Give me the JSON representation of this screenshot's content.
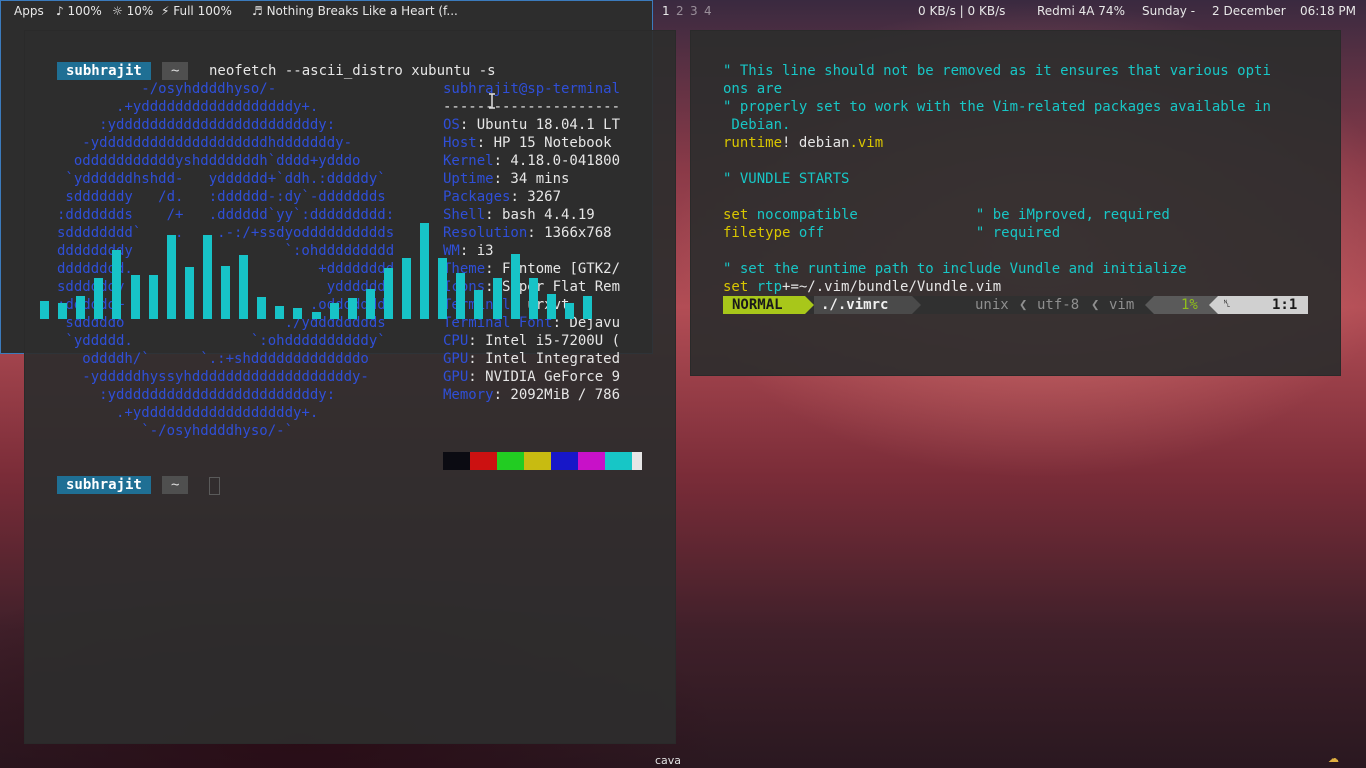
{
  "topbar": {
    "apps": "Apps",
    "volume": "♪ 100%",
    "brightness": "☼ 10%",
    "battery": "⚡ Full 100%",
    "music": "♬ Nothing Breaks Like a Heart (f...",
    "workspaces": [
      "1",
      "2",
      "3",
      "4"
    ],
    "net": "0 KB/s | 0 KB/s",
    "wifi": "Redmi 4A  74%",
    "day": "Sunday -",
    "date": "2 December",
    "time": "06:18 PM"
  },
  "terminal": {
    "user": "subhrajit",
    "dir": "~",
    "command": "neofetch --ascii_distro xubuntu -s",
    "ascii": [
      "          -/osyhddddhyso/-",
      "       .+yddddddddddddddddddy+.",
      "     :yddddddddddddddddddddddddy:",
      "   -yddddddddddddddddddddhdddddddy-",
      "  odddddddddddyshdddddddh`dddd+ydddo",
      " `yddddddhshdd-   ydddddd+`ddh.:dddddy`",
      " sddddddy   /d.   :dddddd-:dy`-ddddddds",
      ":ddddddds    /+   .dddddd`yy`:ddddddddd:",
      "sdddddddd`    .    .-:/+ssdyodddddddddds",
      "ddddddddy                  `:ohddddddddd",
      "dddddddd.                      +dddddddd",
      "sddddddy                        ydddddds",
      ":dddddd+                      .oddddddd:",
      " sdddddo                   ./ydddddddds",
      " `yddddd.              `:ohddddddddddy`",
      "   oddddh/`      `.:+shdddddddddddddo",
      "   -ydddddhyssyhdddddddddddddddddddy-",
      "     :yddddddddddddddddddddddddy:",
      "       .+yddddddddddddddddddy+.",
      "          `-/osyhddddhyso/-`"
    ],
    "info_header": "subhrajit@sp-terminal",
    "info_sep": "---------------------",
    "info": [
      {
        "key": "OS",
        "value": "Ubuntu 18.04.1 LT"
      },
      {
        "key": "Host",
        "value": "HP 15 Notebook"
      },
      {
        "key": "Kernel",
        "value": "4.18.0-041800"
      },
      {
        "key": "Uptime",
        "value": "34 mins"
      },
      {
        "key": "Packages",
        "value": "3267"
      },
      {
        "key": "Shell",
        "value": "bash 4.4.19"
      },
      {
        "key": "Resolution",
        "value": "1366x768"
      },
      {
        "key": "WM",
        "value": "i3"
      },
      {
        "key": "Theme",
        "value": "Fantome [GTK2/"
      },
      {
        "key": "Icons",
        "value": "Super Flat Rem"
      },
      {
        "key": "Terminal",
        "value": "urxvt"
      },
      {
        "key": "Terminal Font",
        "value": "Dejavu"
      },
      {
        "key": "CPU",
        "value": "Intel i5-7200U ("
      },
      {
        "key": "GPU",
        "value": "Intel Integrated"
      },
      {
        "key": "GPU",
        "value": "NVIDIA GeForce 9"
      },
      {
        "key": "Memory",
        "value": "2092MiB / 786"
      }
    ],
    "palette": [
      "#0b0b12",
      "#cc1111",
      "#22cc22",
      "#c8bb11",
      "#1717c8",
      "#c811c8",
      "#17c6c6",
      "#e6e6e6"
    ]
  },
  "vim": {
    "lines": [
      [
        {
          "t": "\" This line should not be removed as it ensures that various opti",
          "c": "cm"
        }
      ],
      [
        {
          "t": "ons are",
          "c": "cm"
        }
      ],
      [
        {
          "t": "\" properly set to work with the Vim-related packages available in",
          "c": "cm"
        }
      ],
      [
        {
          "t": " Debian.",
          "c": "cm"
        }
      ],
      [
        {
          "t": "runtime",
          "c": "kw"
        },
        {
          "t": "! debian",
          "c": "st"
        },
        {
          "t": ".vim",
          "c": "kw"
        }
      ],
      [
        {
          "t": "",
          "c": "st"
        }
      ],
      [
        {
          "t": "\" VUNDLE STARTS",
          "c": "cm"
        }
      ],
      [
        {
          "t": "",
          "c": "st"
        }
      ],
      [
        {
          "t": "set ",
          "c": "kw"
        },
        {
          "t": "nocompatible",
          "c": "id"
        },
        {
          "t": "              ",
          "c": "st"
        },
        {
          "t": "\" be iMproved, required",
          "c": "cm"
        }
      ],
      [
        {
          "t": "filetype ",
          "c": "kw"
        },
        {
          "t": "off",
          "c": "id"
        },
        {
          "t": "                  ",
          "c": "st"
        },
        {
          "t": "\" required",
          "c": "cm"
        }
      ],
      [
        {
          "t": "",
          "c": "st"
        }
      ],
      [
        {
          "t": "\" set the runtime path to include Vundle and initialize",
          "c": "cm"
        }
      ],
      [
        {
          "t": "set ",
          "c": "kw"
        },
        {
          "t": "rtp",
          "c": "id"
        },
        {
          "t": "+=~/.vim/bundle/Vundle.vim",
          "c": "st"
        }
      ]
    ],
    "status": {
      "mode": "NORMAL",
      "file": "./.vimrc",
      "format": "unix",
      "encoding": "utf-8",
      "filetype": "vim",
      "percent": "1%",
      "ln_icon": "␤",
      "position": "1:1"
    }
  },
  "cava": {
    "levels": [
      0.19,
      0.17,
      0.24,
      0.43,
      0.72,
      0.46,
      0.46,
      0.87,
      0.54,
      0.87,
      0.55,
      0.67,
      0.23,
      0.14,
      0.11,
      0.07,
      0.17,
      0.22,
      0.31,
      0.53,
      0.64,
      1.0,
      0.64,
      0.48,
      0.3,
      0.43,
      0.68,
      0.43,
      0.26,
      0.17,
      0.24
    ]
  },
  "taskbar": {
    "label": "cava",
    "tray_icon": "☁"
  }
}
